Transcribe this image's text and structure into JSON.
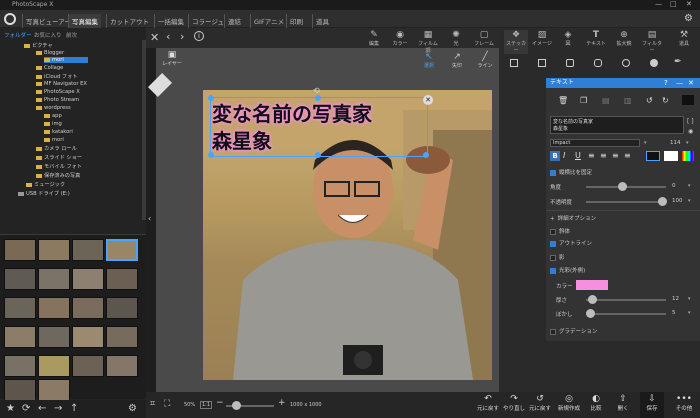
{
  "app": {
    "title": "PhotoScape X"
  },
  "menu": {
    "tabs": [
      "写真ビューアー",
      "写真編集",
      "カットアウト",
      "一括編集",
      "コラージュ",
      "連結",
      "GIFアニメ",
      "印刷",
      "道具"
    ],
    "active": "写真編集"
  },
  "left": {
    "tabs": [
      "フォルダー",
      "お気に入り",
      "前次"
    ],
    "tree": [
      "ピクチャ",
      "Blogger",
      "mori",
      "Collage",
      "iCloud フォト",
      "MF Navigator EX",
      "PhotoScape X",
      "Photo Stream",
      "wordpress",
      "app",
      "img",
      "katakori",
      "mori",
      "カメラ ロール",
      "スライド ショー",
      "モバイル フォト",
      "保存済みの写真",
      "ミュージック",
      "USB ドライブ (E:)"
    ],
    "selected": "mori"
  },
  "canvas_tools": {
    "layer": "レイヤー",
    "select": "選択",
    "arrow": "矢印",
    "line": "ライン"
  },
  "overlay_text": {
    "line1": "変な名前の写真家",
    "line2": "森星象"
  },
  "right_tools": [
    "編集",
    "カラー",
    "フィルム調",
    "光",
    "フレーム",
    "ステッカー",
    "イメージ",
    "図",
    "テキスト",
    "拡大鏡",
    "フィルター",
    "道具"
  ],
  "text_panel": {
    "title": "テキスト",
    "content_line1": "変な名前の写真家",
    "content_line2": "森星象",
    "font": "Impact",
    "font_size": "114",
    "keep_ratio": "縦横比を固定",
    "angle_label": "角度",
    "angle_value": "0",
    "opacity_label": "不透明度",
    "opacity_value": "100",
    "details": "詳細オプション",
    "italic": "斜体",
    "outline": "アウトライン",
    "shadow": "影",
    "glow": "光彩(外側)",
    "color_label": "カラー",
    "thickness_label": "厚さ",
    "thickness_value": "12",
    "blur_label": "ぼかし",
    "blur_value": "5",
    "gradient": "グラデーション",
    "glow_color": "#f58fe0"
  },
  "status": {
    "zoom": "50%",
    "fit": "1:1",
    "size": "1000 x 1000"
  },
  "bottom_actions": [
    "元に戻す",
    "やり直し",
    "元に戻す",
    "新規作成",
    "比較",
    "開く",
    "保存",
    "その他"
  ]
}
